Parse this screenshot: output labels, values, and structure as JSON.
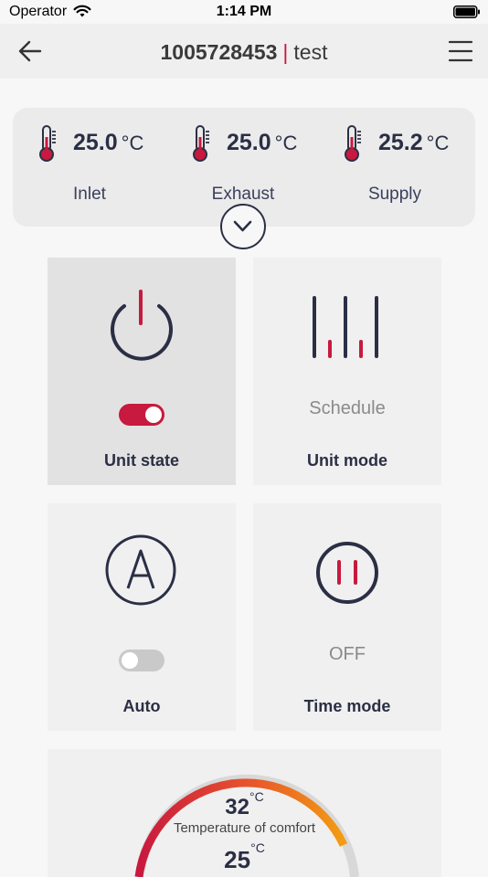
{
  "status_bar": {
    "carrier": "Operator",
    "time": "1:14 PM"
  },
  "header": {
    "device_id": "1005728453",
    "separator": "|",
    "device_name": "test"
  },
  "temperatures": [
    {
      "value": "25.0",
      "unit": "°C",
      "label": "Inlet"
    },
    {
      "value": "25.0",
      "unit": "°C",
      "label": "Exhaust"
    },
    {
      "value": "25.2",
      "unit": "°C",
      "label": "Supply"
    }
  ],
  "tiles": {
    "unit_state": {
      "label": "Unit state",
      "toggle_on": true
    },
    "unit_mode": {
      "label": "Unit mode",
      "status": "Schedule"
    },
    "auto": {
      "label": "Auto",
      "toggle_on": false
    },
    "time_mode": {
      "label": "Time mode",
      "status": "OFF"
    }
  },
  "comfort": {
    "set_value": "32",
    "set_unit": "°C",
    "label": "Temperature of comfort",
    "current_value": "25",
    "current_unit": "°C"
  },
  "colors": {
    "accent": "#c8193e",
    "navy": "#2b2f45",
    "gauge_orange": "#f39c12"
  },
  "icons": {
    "back": "arrow-left-icon",
    "menu": "hamburger-menu-icon",
    "thermometer": "thermometer-icon",
    "expand": "chevron-down-icon",
    "power": "power-icon",
    "mode": "bars-icon",
    "auto": "letter-a-circle-icon",
    "pause": "pause-circle-icon"
  }
}
